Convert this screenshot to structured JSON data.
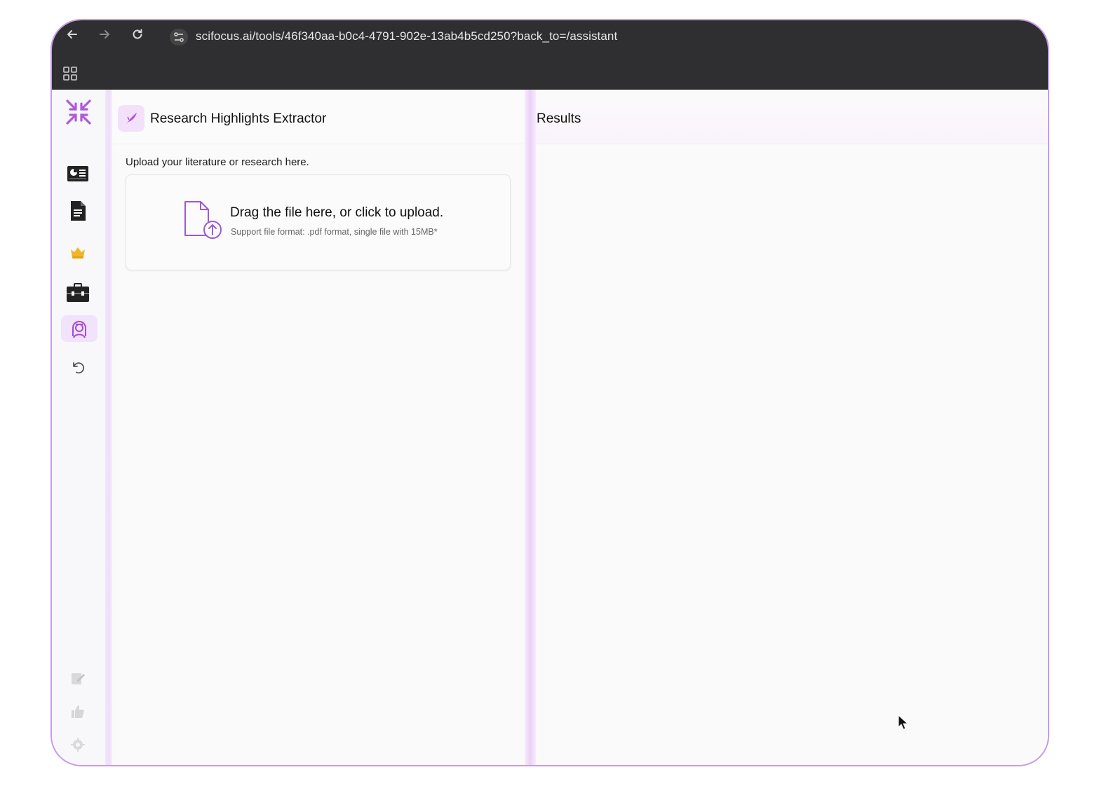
{
  "browser": {
    "url": "scifocus.ai/tools/46f340aa-b0c4-4791-902e-13ab4b5cd250?back_to=/assistant",
    "back_icon": "arrow-left-icon",
    "forward_icon": "arrow-right-icon",
    "reload_icon": "reload-icon",
    "apps_icon": "grid-icon"
  },
  "sidebar": {
    "logo_icon": "scifocus-logo-icon",
    "items": [
      {
        "icon": "dashboard-card-icon"
      },
      {
        "icon": "document-icon"
      },
      {
        "icon": "crown-icon"
      },
      {
        "icon": "toolbox-icon"
      },
      {
        "icon": "assistant-avatar-icon",
        "active": true
      },
      {
        "icon": "undo-icon"
      }
    ],
    "bottom_items": [
      {
        "icon": "edit-note-icon"
      },
      {
        "icon": "thumbs-up-icon"
      },
      {
        "icon": "settings-icon"
      }
    ]
  },
  "left_panel": {
    "tool_title": "Research Highlights Extractor",
    "upload_label": "Upload your literature or research here.",
    "dropzone": {
      "title": "Drag the file here, or click to upload.",
      "subtitle": "Support file format: .pdf format, single file with 15MB*"
    }
  },
  "right_panel": {
    "title": "Results"
  },
  "colors": {
    "accent": "#a64bd6",
    "accent_light": "#f1e3fb",
    "chrome": "#2f2f31"
  }
}
